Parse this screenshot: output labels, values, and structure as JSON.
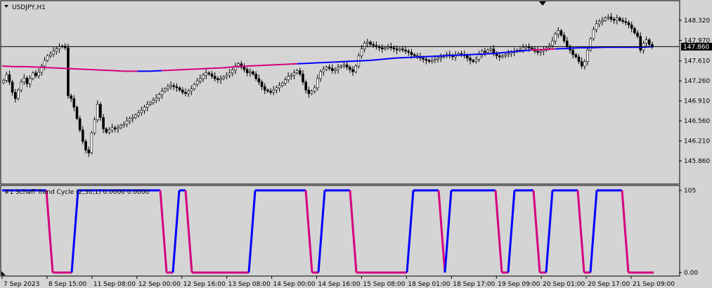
{
  "symbol_label": "USDJPY,H1",
  "indicator_label": "#1 Schaff Trend Cycle (2,50,1) 0.0000 0.0000",
  "current_price": "147.860",
  "colors": {
    "background": "#d4d4d4",
    "grid": "#000000",
    "candle_up": "#ffffff",
    "candle_down": "#000000",
    "ma_up": "#0000ff",
    "ma_down": "#d4007f",
    "stc_up": "#0000ff",
    "stc_down": "#d4007f",
    "price_line": "#000000"
  },
  "chart_data": [
    {
      "type": "candlestick",
      "title": "USDJPY,H1",
      "y_ticks": [
        "148.320",
        "147.970",
        "147.610",
        "147.260",
        "146.910",
        "146.560",
        "146.210",
        "145.860"
      ],
      "x_ticks": [
        "7 Sep 2023",
        "8 Sep 15:00",
        "11 Sep 08:00",
        "12 Sep 00:00",
        "12 Sep 16:00",
        "13 Sep 08:00",
        "14 Sep 00:00",
        "14 Sep 16:00",
        "15 Sep 08:00",
        "18 Sep 01:00",
        "18 Sep 17:00",
        "19 Sep 09:00",
        "20 Sep 01:00",
        "20 Sep 17:00",
        "21 Sep 09:00"
      ],
      "ylim": [
        145.81,
        148.45
      ],
      "close": [
        147.27,
        147.37,
        147.24,
        147.06,
        146.95,
        147.1,
        147.24,
        147.31,
        147.21,
        147.3,
        147.4,
        147.35,
        147.41,
        147.52,
        147.62,
        147.7,
        147.73,
        147.78,
        147.82,
        147.86,
        147.87,
        147.84,
        147.0,
        146.95,
        146.8,
        146.6,
        146.4,
        146.2,
        146.05,
        146.0,
        146.35,
        146.58,
        146.85,
        146.62,
        146.42,
        146.36,
        146.4,
        146.44,
        146.42,
        146.44,
        146.48,
        146.5,
        146.56,
        146.6,
        146.62,
        146.66,
        146.7,
        146.74,
        146.8,
        146.85,
        146.88,
        146.92,
        146.96,
        147.02,
        147.08,
        147.12,
        147.16,
        147.18,
        147.16,
        147.14,
        147.1,
        147.06,
        147.04,
        147.08,
        147.12,
        147.2,
        147.26,
        147.3,
        147.36,
        147.4,
        147.38,
        147.34,
        147.3,
        147.28,
        147.3,
        147.33,
        147.36,
        147.4,
        147.45,
        147.52,
        147.56,
        147.5,
        147.46,
        147.4,
        147.42,
        147.38,
        147.3,
        147.24,
        147.16,
        147.1,
        147.08,
        147.06,
        147.1,
        147.14,
        147.18,
        147.22,
        147.28,
        147.34,
        147.36,
        147.4,
        147.44,
        147.38,
        147.24,
        147.1,
        147.04,
        147.08,
        147.14,
        147.3,
        147.42,
        147.46,
        147.5,
        147.48,
        147.44,
        147.46,
        147.5,
        147.52,
        147.54,
        147.5,
        147.46,
        147.42,
        147.52,
        147.7,
        147.82,
        147.92,
        147.94,
        147.9,
        147.88,
        147.86,
        147.84,
        147.82,
        147.84,
        147.86,
        147.84,
        147.82,
        147.8,
        147.82,
        147.8,
        147.78,
        147.76,
        147.72,
        147.7,
        147.68,
        147.66,
        147.64,
        147.62,
        147.6,
        147.62,
        147.64,
        147.66,
        147.68,
        147.7,
        147.72,
        147.7,
        147.68,
        147.72,
        147.74,
        147.72,
        147.7,
        147.66,
        147.62,
        147.6,
        147.64,
        147.72,
        147.78,
        147.76,
        147.8,
        147.82,
        147.74,
        147.7,
        147.68,
        147.7,
        147.72,
        147.74,
        147.76,
        147.78,
        147.8,
        147.8,
        147.84,
        147.86,
        147.84,
        147.82,
        147.78,
        147.76,
        147.78,
        147.8,
        147.84,
        147.88,
        147.96,
        148.08,
        148.14,
        148.06,
        147.96,
        147.86,
        147.8,
        147.72,
        147.68,
        147.6,
        147.52,
        147.6,
        147.8,
        148.0,
        148.16,
        148.26,
        148.3,
        148.32,
        148.36,
        148.38,
        148.34,
        148.32,
        148.36,
        148.32,
        148.3,
        148.28,
        148.24,
        148.18,
        148.1,
        148.04,
        147.8,
        147.92,
        147.98,
        147.9,
        147.86
      ],
      "price_line": 147.86,
      "ma_values": [
        147.52,
        147.51,
        147.51,
        147.5,
        147.49,
        147.48,
        147.47,
        147.46,
        147.45,
        147.44,
        147.43,
        147.43,
        147.43,
        147.44,
        147.45,
        147.46,
        147.47,
        147.48,
        147.49,
        147.51,
        147.52,
        147.53,
        147.54,
        147.55,
        147.56,
        147.57,
        147.58,
        147.59,
        147.6,
        147.61,
        147.62,
        147.64,
        147.66,
        147.67,
        147.68,
        147.69,
        147.7,
        147.71,
        147.72,
        147.73,
        147.74,
        147.76,
        147.78,
        147.8,
        147.81,
        147.82,
        147.83,
        147.84,
        147.84,
        147.85,
        147.85,
        147.85,
        147.85,
        147.86
      ],
      "ma_colors": [
        "down",
        "down",
        "down",
        "down",
        "down",
        "down",
        "down",
        "down",
        "down",
        "down",
        "down",
        "up",
        "up",
        "down",
        "down",
        "down",
        "down",
        "down",
        "down",
        "down",
        "down",
        "down",
        "down",
        "down",
        "up",
        "up",
        "up",
        "up",
        "up",
        "up",
        "up",
        "up",
        "up",
        "up",
        "up",
        "up",
        "up",
        "up",
        "up",
        "up",
        "up",
        "up",
        "up",
        "down",
        "down",
        "up",
        "up",
        "up",
        "up",
        "up",
        "up",
        "up",
        "up",
        "up"
      ]
    },
    {
      "type": "line",
      "title": "#1 Schaff Trend Cycle (2,50,1) 0.0000 0.0000",
      "y_ticks": [
        "105",
        "0.00"
      ],
      "ylim": [
        0,
        105
      ],
      "series": [
        {
          "values": [
            105,
            105,
            105,
            105,
            105,
            105,
            105,
            105,
            0,
            0,
            0,
            0,
            105,
            105,
            105,
            105,
            105,
            105,
            105,
            105,
            105,
            105,
            105,
            105,
            105,
            105,
            0,
            0,
            105,
            105,
            0,
            0,
            0,
            0,
            0,
            0,
            0,
            0,
            0,
            0,
            105,
            105,
            105,
            105,
            105,
            105,
            105,
            105,
            105,
            0,
            0,
            105,
            105,
            105,
            105,
            105,
            0,
            0,
            0,
            0,
            0,
            0,
            0,
            0,
            0,
            105,
            105,
            105,
            105,
            105,
            0,
            105,
            105,
            105,
            105,
            105,
            105,
            105,
            105,
            0,
            0,
            105,
            105,
            105,
            105,
            0,
            0,
            105,
            105,
            105,
            105,
            105,
            0,
            0,
            105,
            105,
            105,
            105,
            105,
            0,
            0,
            0,
            0,
            0
          ]
        }
      ]
    }
  ]
}
